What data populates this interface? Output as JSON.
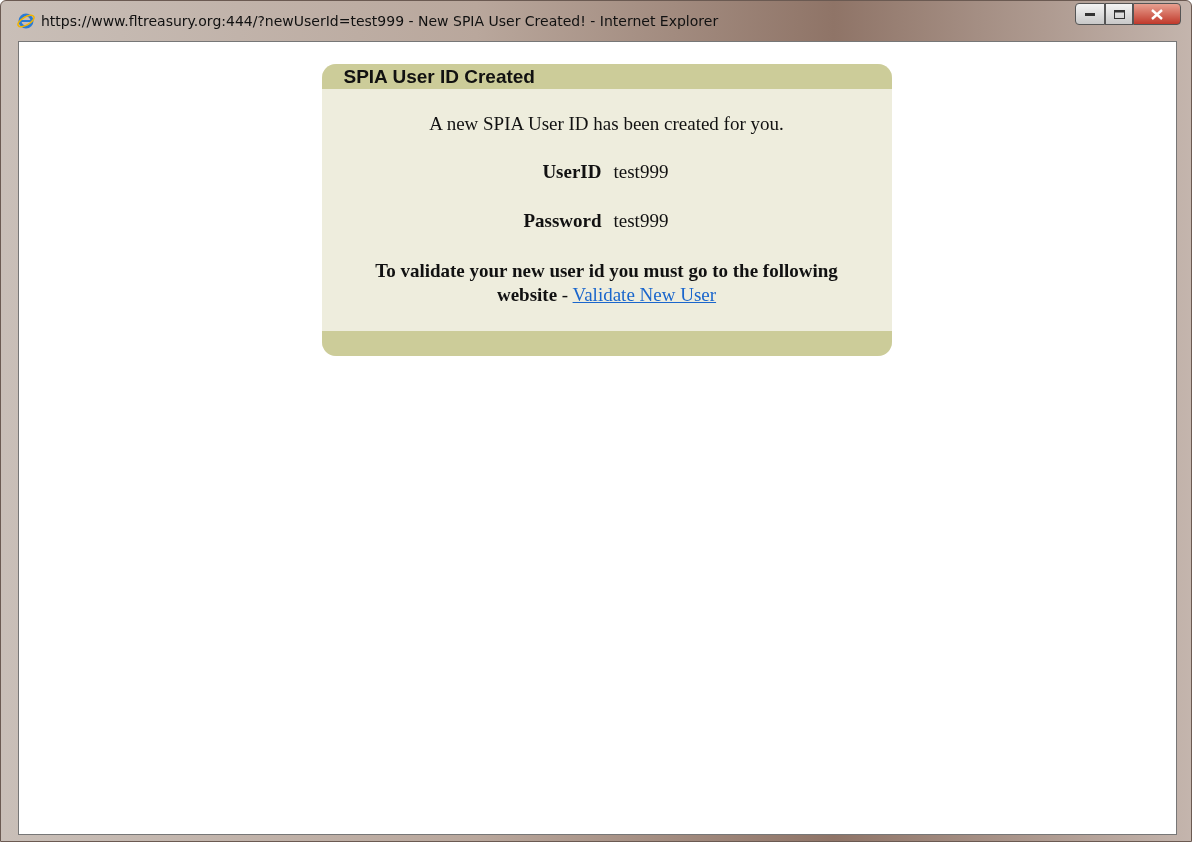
{
  "window": {
    "title": "https://www.fltreasury.org:444/?newUserId=test999 - New SPIA User Created! - Internet Explorer"
  },
  "panel": {
    "title": "SPIA User ID Created",
    "message": "A new SPIA User ID has been created for you.",
    "fields": [
      {
        "label": "UserID",
        "value": "test999"
      },
      {
        "label": "Password",
        "value": "test999"
      }
    ],
    "instruction": "**To validate your new user id you must go to the following website** -",
    "link": "Validate New User"
  }
}
